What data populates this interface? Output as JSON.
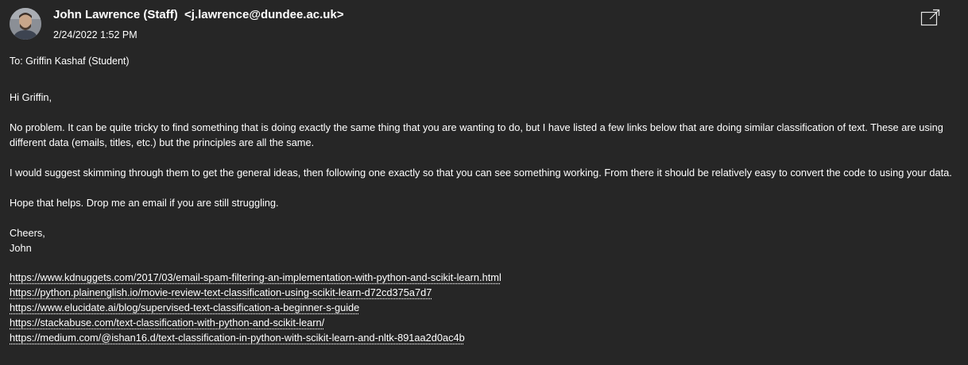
{
  "header": {
    "sender_name": "John Lawrence (Staff)",
    "sender_email": "<j.lawrence@dundee.ac.uk>",
    "date": "2/24/2022 1:52 PM",
    "popout_icon": "popout-icon"
  },
  "recipients": {
    "to": "To: Griffin Kashaf (Student)"
  },
  "body": {
    "greeting": "Hi Griffin,",
    "para1": "No problem. It can be quite tricky to find something that is doing exactly the same thing that you are wanting to do, but I have listed a few links below that are doing similar classification of text. These are using different data (emails, titles, etc.) but the principles are all the same.",
    "para2": "I would suggest skimming through them to get the general ideas, then following one exactly so that you can see something working. From there it should be relatively easy to convert the code to using your data.",
    "para3": "Hope that helps. Drop me an email if you are still struggling.",
    "signoff": "Cheers,",
    "signature": "John",
    "links": [
      "https://www.kdnuggets.com/2017/03/email-spam-filtering-an-implementation-with-python-and-scikit-learn.html",
      "https://python.plainenglish.io/movie-review-text-classification-using-scikit-learn-d72cd375a7d7",
      "https://www.elucidate.ai/blog/supervised-text-classification-a-beginner-s-guide",
      "https://stackabuse.com/text-classification-with-python-and-scikit-learn/",
      "https://medium.com/@ishan16.d/text-classification-in-python-with-scikit-learn-and-nltk-891aa2d0ac4b"
    ]
  }
}
